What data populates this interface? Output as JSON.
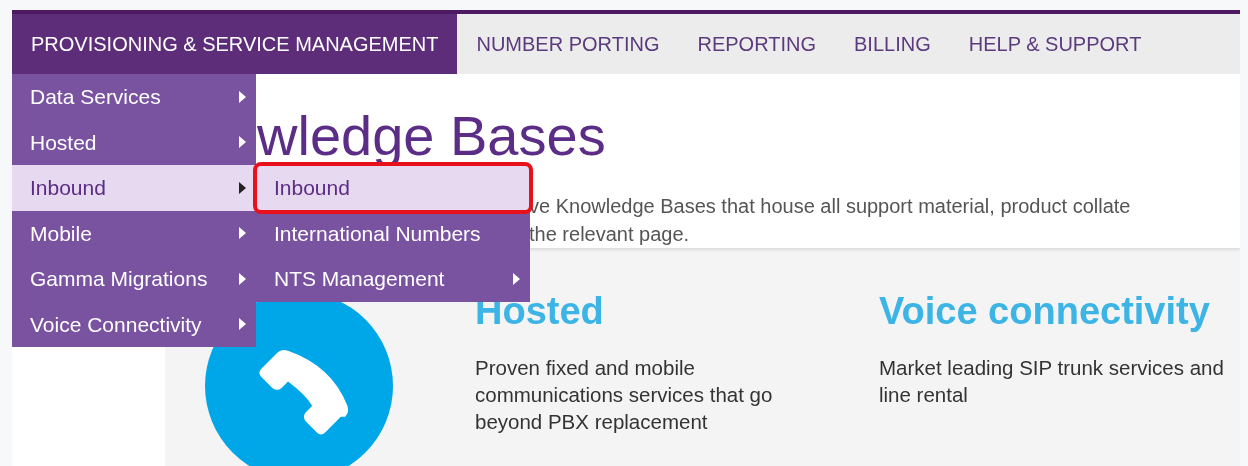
{
  "nav": [
    {
      "label": "PROVISIONING & SERVICE MANAGEMENT",
      "selected": true
    },
    {
      "label": "NUMBER PORTING",
      "selected": false
    },
    {
      "label": "REPORTING",
      "selected": false
    },
    {
      "label": "BILLING",
      "selected": false
    },
    {
      "label": "HELP & SUPPORT",
      "selected": false
    }
  ],
  "menu": [
    {
      "label": "Data Services",
      "selected": false,
      "has_submenu": true
    },
    {
      "label": "Hosted",
      "selected": false,
      "has_submenu": true
    },
    {
      "label": "Inbound",
      "selected": true,
      "has_submenu": true
    },
    {
      "label": "Mobile",
      "selected": false,
      "has_submenu": true
    },
    {
      "label": "Gamma Migrations",
      "selected": false,
      "has_submenu": true
    },
    {
      "label": "Voice Connectivity",
      "selected": false,
      "has_submenu": true
    }
  ],
  "submenu": [
    {
      "label": "Inbound",
      "selected": true,
      "has_submenu": false,
      "highlighted": true
    },
    {
      "label": "International Numbers",
      "selected": false,
      "has_submenu": false,
      "highlighted": false
    },
    {
      "label": "NTS Management",
      "selected": false,
      "has_submenu": true,
      "highlighted": false
    }
  ],
  "intro": {
    "heading": "wledge Bases",
    "text_lines": [
      "ve Knowledge Bases that house all support material, product collate",
      "the relevant page."
    ]
  },
  "cards": [
    {
      "title": "Hosted",
      "text": "Proven fixed and mobile communications services that go beyond PBX replacement"
    },
    {
      "title": "Voice connectivity",
      "text": "Market leading SIP trunk services and line rental"
    }
  ]
}
